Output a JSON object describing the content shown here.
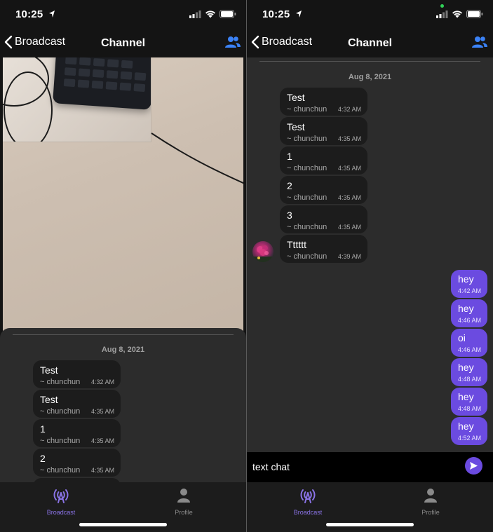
{
  "status_bar": {
    "time": "10:25"
  },
  "nav": {
    "back_label": "Broadcast",
    "title": "Channel"
  },
  "date_separator": "Aug 8, 2021",
  "left_screen": {
    "messages": [
      {
        "text": "Test",
        "author": "~ chunchun",
        "time": "4:32 AM"
      },
      {
        "text": "Test",
        "author": "~ chunchun",
        "time": "4:35 AM"
      },
      {
        "text": "1",
        "author": "~ chunchun",
        "time": "4:35 AM"
      },
      {
        "text": "2",
        "author": "~ chunchun",
        "time": "4:35 AM"
      }
    ]
  },
  "right_screen": {
    "messages": [
      {
        "text": "Test",
        "author": "~ chunchun",
        "time": "4:32 AM"
      },
      {
        "text": "Test",
        "author": "~ chunchun",
        "time": "4:35 AM"
      },
      {
        "text": "1",
        "author": "~ chunchun",
        "time": "4:35 AM"
      },
      {
        "text": "2",
        "author": "~ chunchun",
        "time": "4:35 AM"
      },
      {
        "text": "3",
        "author": "~ chunchun",
        "time": "4:35 AM"
      },
      {
        "text": "Tttttt",
        "author": "~ chunchun",
        "time": "4:39 AM"
      }
    ],
    "my_messages": [
      {
        "text": "hey",
        "time": "4:42 AM"
      },
      {
        "text": "hey",
        "time": "4:46 AM"
      },
      {
        "text": "oi",
        "time": "4:46 AM"
      },
      {
        "text": "hey",
        "time": "4:48 AM"
      },
      {
        "text": "hey",
        "time": "4:48 AM"
      },
      {
        "text": "hey",
        "time": "4:52 AM"
      }
    ],
    "input_value": "text chat"
  },
  "tabs": [
    {
      "label": "Broadcast",
      "icon": "broadcast-icon",
      "active": true
    },
    {
      "label": "Profile",
      "icon": "person-icon",
      "active": false
    }
  ],
  "colors": {
    "accent": "#6b4be0",
    "tab_active": "#8a73e6",
    "link_blue": "#3b82f6",
    "background": "#141414",
    "chat_bg": "#2c2c2c"
  }
}
